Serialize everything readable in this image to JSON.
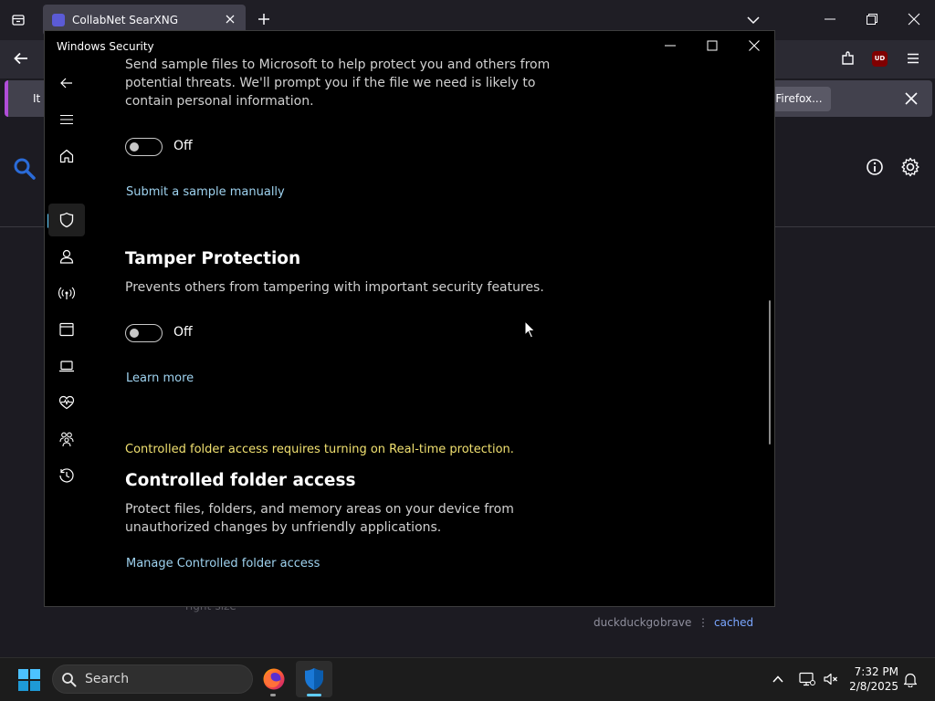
{
  "firefox": {
    "tab_title": "CollabNet SearXNG",
    "notice_text": "It",
    "notice_button": "Firefox...",
    "footer_hidden_text": "right-size",
    "engines": [
      "duckduckgo",
      "brave",
      "⋮",
      "cached"
    ]
  },
  "winsec": {
    "title": "Windows Security",
    "sample_desc": "Send sample files to Microsoft to help protect you and others from potential threats. We'll prompt you if the file we need is likely to contain personal information.",
    "sample_toggle_state": "Off",
    "submit_link": "Submit a sample manually",
    "tamper_heading": "Tamper Protection",
    "tamper_desc": "Prevents others from tampering with important security features.",
    "tamper_toggle_state": "Off",
    "learn_more": "Learn more",
    "cfa_warning": "Controlled folder access requires turning on Real-time protection.",
    "cfa_heading": "Controlled folder access",
    "cfa_desc": "Protect files, folders, and memory areas on your device from unauthorized changes by unfriendly applications.",
    "cfa_link": "Manage Controlled folder access"
  },
  "taskbar": {
    "search_label": "Search",
    "time": "7:32 PM",
    "date": "2/8/2025"
  },
  "colors": {
    "accent": "#60cdff",
    "link": "#9fd3f0",
    "warning": "#f0e070"
  }
}
